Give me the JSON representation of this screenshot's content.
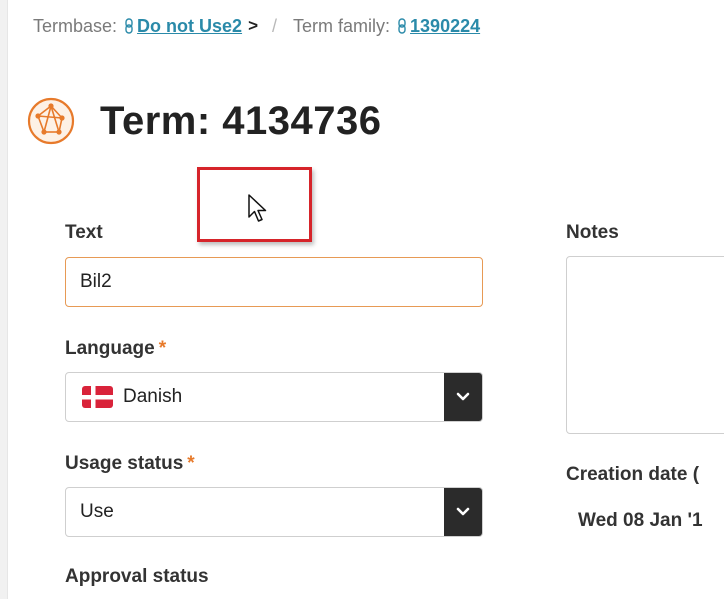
{
  "breadcrumb": {
    "termbase_label": "Termbase:",
    "termbase_link": "Do not Use2",
    "arrow": ">",
    "separator": "/",
    "term_family_label": "Term family:",
    "term_family_link": "1390224"
  },
  "header": {
    "title": "Term: 4134736",
    "icon": "globe-network-icon"
  },
  "form": {
    "text": {
      "label": "Text",
      "value": "Bil2"
    },
    "language": {
      "label": "Language",
      "required_mark": "*",
      "value": "Danish",
      "flag": "danish-flag-icon"
    },
    "usage_status": {
      "label": "Usage status",
      "required_mark": "*",
      "value": "Use"
    },
    "approval_status": {
      "label": "Approval status"
    },
    "notes": {
      "label": "Notes"
    },
    "creation_date": {
      "label": "Creation date (",
      "value": "Wed 08 Jan '1"
    }
  },
  "colors": {
    "accent_orange": "#e77a2b",
    "link_blue": "#2a8aa9",
    "highlight_red": "#d6242a",
    "caret_dark": "#2b2b2b"
  }
}
